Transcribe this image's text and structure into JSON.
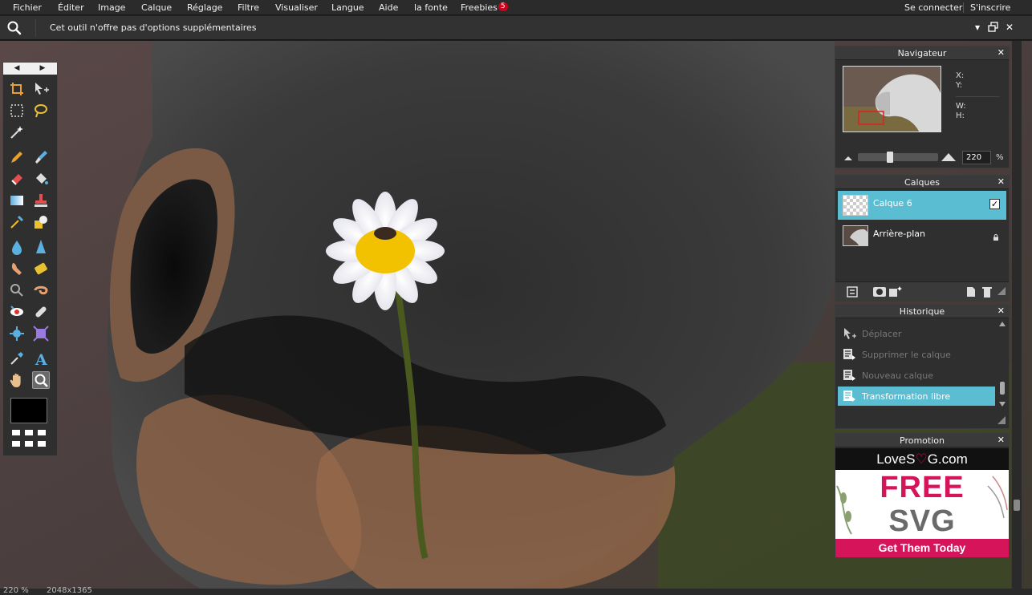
{
  "menubar": {
    "items": [
      "Fichier",
      "Éditer",
      "Image",
      "Calque",
      "Réglage",
      "Filtre",
      "Visualiser",
      "Langue",
      "Aide",
      "la fonte",
      "Freebies"
    ],
    "freebies_badge": "5",
    "login": "Se connecter",
    "signup": "S'inscrire"
  },
  "optionsbar": {
    "message": "Cet outil n'offre pas d'options supplémentaires",
    "active_tool_icon": "zoom-icon"
  },
  "navigator": {
    "title": "Navigateur",
    "x_label": "X:",
    "y_label": "Y:",
    "w_label": "W:",
    "h_label": "H:",
    "zoom_value": "220",
    "zoom_unit": "%",
    "zoom_slider_fraction": 0.4
  },
  "layers": {
    "title": "Calques",
    "items": [
      {
        "name": "Calque 6",
        "visible": true,
        "selected": true
      },
      {
        "name": "Arrière-plan",
        "locked": true,
        "selected": false
      }
    ]
  },
  "history": {
    "title": "Historique",
    "items": [
      {
        "label": "Déplacer",
        "icon": "move-icon"
      },
      {
        "label": "Supprimer le calque",
        "icon": "history-step-icon"
      },
      {
        "label": "Nouveau calque",
        "icon": "history-step-icon"
      },
      {
        "label": "Transformation libre",
        "icon": "history-step-icon",
        "selected": true
      }
    ]
  },
  "promotion": {
    "title": "Promotion",
    "brand_prefix": "LoveS",
    "brand_suffix": "G.com",
    "headline_1": "FREE",
    "headline_2": "SVG",
    "cta": "Get Them Today"
  },
  "status": {
    "zoom": "220 %",
    "size": "2048x1365"
  },
  "colors": {
    "accent": "#5bbdd2",
    "promo_pink": "#d6145a",
    "foreground_color": "#000000"
  }
}
